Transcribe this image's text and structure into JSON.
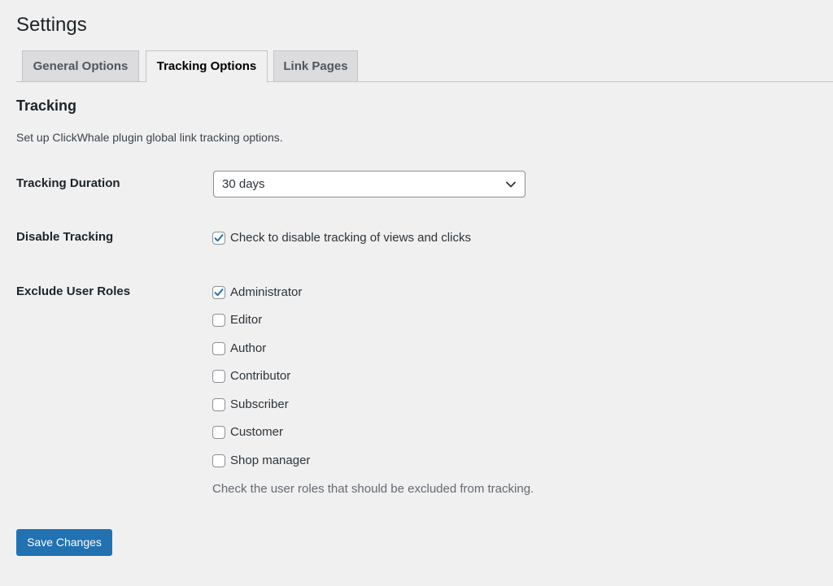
{
  "page": {
    "title": "Settings"
  },
  "tabs": [
    {
      "label": "General Options",
      "active": false
    },
    {
      "label": "Tracking Options",
      "active": true
    },
    {
      "label": "Link Pages",
      "active": false
    }
  ],
  "section": {
    "heading": "Tracking",
    "description": "Set up ClickWhale plugin global link tracking options."
  },
  "tracking_duration": {
    "label": "Tracking Duration",
    "selected": "30 days",
    "icon": "chevron-down-icon"
  },
  "disable_tracking": {
    "label": "Disable Tracking",
    "checkbox_label": "Check to disable tracking of views and clicks",
    "checked": true
  },
  "exclude_roles": {
    "label": "Exclude User Roles",
    "roles": [
      {
        "label": "Administrator",
        "checked": true
      },
      {
        "label": "Editor",
        "checked": false
      },
      {
        "label": "Author",
        "checked": false
      },
      {
        "label": "Contributor",
        "checked": false
      },
      {
        "label": "Subscriber",
        "checked": false
      },
      {
        "label": "Customer",
        "checked": false
      },
      {
        "label": "Shop manager",
        "checked": false
      }
    ],
    "help": "Check the user roles that should be excluded from tracking."
  },
  "save_button": {
    "label": "Save Changes"
  },
  "colors": {
    "accent": "#2271b1",
    "background": "#f0f0f1",
    "text": "#1d2327"
  }
}
